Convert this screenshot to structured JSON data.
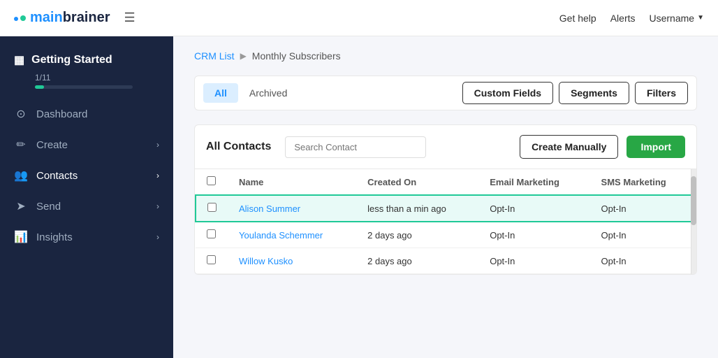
{
  "topNav": {
    "logoText1": "main",
    "logoText2": "brainer",
    "getHelp": "Get help",
    "alerts": "Alerts",
    "username": "Username"
  },
  "sidebar": {
    "gettingStarted": {
      "label": "Getting Started",
      "progress": "1/11",
      "progressPct": 9
    },
    "items": [
      {
        "id": "dashboard",
        "label": "Dashboard",
        "icon": "👤",
        "arrow": false
      },
      {
        "id": "create",
        "label": "Create",
        "icon": "✏️",
        "arrow": true
      },
      {
        "id": "contacts",
        "label": "Contacts",
        "icon": "👥",
        "arrow": true
      },
      {
        "id": "send",
        "label": "Send",
        "icon": "📤",
        "arrow": true
      },
      {
        "id": "insights",
        "label": "Insights",
        "icon": "📊",
        "arrow": true
      }
    ]
  },
  "breadcrumb": {
    "link": "CRM List",
    "separator": "▶",
    "current": "Monthly Subscribers"
  },
  "tabs": {
    "all": "All",
    "archived": "Archived",
    "customFields": "Custom Fields",
    "segments": "Segments",
    "filters": "Filters"
  },
  "contactsSection": {
    "title": "All Contacts",
    "searchPlaceholder": "Search Contact",
    "createManually": "Create Manually",
    "import": "Import"
  },
  "tableHeaders": {
    "name": "Name",
    "createdOn": "Created On",
    "emailMarketing": "Email Marketing",
    "smsMarketing": "SMS Marketing"
  },
  "contacts": [
    {
      "name": "Alison Summer",
      "createdOn": "less than a min ago",
      "emailMarketing": "Opt-In",
      "smsMarketing": "Opt-In",
      "highlighted": true
    },
    {
      "name": "Youlanda Schemmer",
      "createdOn": "2 days ago",
      "emailMarketing": "Opt-In",
      "smsMarketing": "Opt-In",
      "highlighted": false
    },
    {
      "name": "Willow Kusko",
      "createdOn": "2 days ago",
      "emailMarketing": "Opt-In",
      "smsMarketing": "Opt-In",
      "highlighted": false
    }
  ]
}
